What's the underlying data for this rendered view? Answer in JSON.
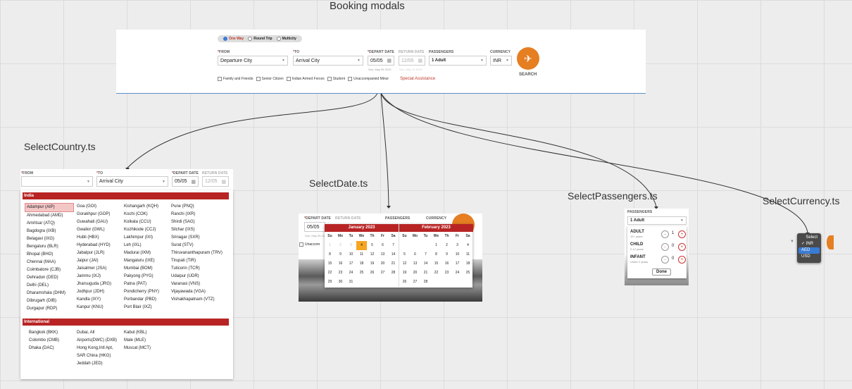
{
  "titles": {
    "page": "Booking modals",
    "select_country": "SelectCountry.ts",
    "select_date": "SelectDate.ts",
    "select_passengers": "SelectPassengers.ts",
    "select_currency": "SelectCurrency.ts"
  },
  "main_form": {
    "trip_types": [
      "One Way",
      "Round Trip",
      "Multicity"
    ],
    "from_label": "FROM",
    "from_value": "Departure City",
    "to_label": "TO",
    "to_value": "Arrival City",
    "depart_label": "DEPART DATE",
    "depart_value": "05/05",
    "depart_sub": "Sun, May 05 2019",
    "return_label": "RETURN DATE",
    "return_value": "12/05",
    "return_sub": "Sun, May 12 2019",
    "passengers_label": "PASSENGERS",
    "passengers_value": "1 Adult",
    "currency_label": "CURRENCY",
    "currency_value": "INR",
    "search_label": "SEARCH",
    "options": [
      "Family and Friends",
      "Senior Citizen",
      "Indian Armed Forces",
      "Student",
      "Unaccompanied Minor"
    ],
    "special": "Special Assistance"
  },
  "country": {
    "from_label": "FROM",
    "to_label": "TO",
    "to_value": "Arrival City",
    "depart_label": "DEPART DATE",
    "depart_value": "05/05",
    "return_label": "RETURN DATE",
    "return_value": "12/05",
    "india_header": "India",
    "india_cols": [
      [
        "Adampur (AIP)",
        "Ahmedabad (AMD)",
        "Amritsar (ATQ)",
        "Bagdogra (IXB)",
        "Belagavi (IXG)",
        "Bengaluru (BLR)",
        "Bhopal (BHO)",
        "Chennai (MAA)",
        "Coimbatore (CJB)",
        "Dehradun (DED)",
        "Delhi (DEL)",
        "Dharamshala (DHM)",
        "Dibrugarh (DIB)",
        "Durgapur (RDP)"
      ],
      [
        "Goa (GOI)",
        "Gorakhpur (GOP)",
        "Guwahati (GAU)",
        "Gwalior (GWL)",
        "Hubli (HBX)",
        "Hyderabad (HYD)",
        "Jabalpur (JLR)",
        "Jaipur (JAI)",
        "Jaisalmer (JSA)",
        "Jammu (IXJ)",
        "Jharsuguda (JRG)",
        "Jodhpur (JDH)",
        "Kandla (IXY)",
        "Kanpur (KNU)"
      ],
      [
        "Kishangarh (KQH)",
        "Kochi (COK)",
        "Kolkata (CCU)",
        "Kozhikode (CCJ)",
        "Lakhimpur (IXI)",
        "Leh (IXL)",
        "Madurai (IXM)",
        "Mangaluru (IXE)",
        "Mumbai (BOM)",
        "Pakyong (PYG)",
        "Patna (PAT)",
        "Pondicherry (PNY)",
        "Porbandar (PBD)",
        "Port Blair (IXZ)"
      ],
      [
        "Pune (PNQ)",
        "Ranchi (IXR)",
        "Shirdi (SAG)",
        "Silchar (IXS)",
        "Srinagar (SXR)",
        "Surat (STV)",
        "Thiruvananthapuram (TRV)",
        "Tirupati (TIR)",
        "Tuticorin (TCR)",
        "Udaipur (UDR)",
        "Varanasi (VNS)",
        "Vijayawada (VGA)",
        "Vishakhapatnam (VTZ)"
      ]
    ],
    "intl_header": "International",
    "intl_cols": [
      [
        "Bangkok (BKK)",
        "Colombo (CMB)",
        "Dhaka (DAC)"
      ],
      [
        "Dubai, All Airports(DWC) (DXB)",
        "Hong Kong,Intl Apt, SAR China (HKG)",
        "Jeddah (JED)"
      ],
      [
        "Kabul (KBL)",
        "Male (MLE)",
        "Muscat (MCT)"
      ]
    ]
  },
  "date": {
    "depart_label": "DEPART DATE",
    "return_label": "RETURN DATE",
    "passengers_label": "PASSENGERS",
    "currency_label": "CURRENCY",
    "depart_value": "05/05",
    "depart_sub": "Sun, May 05 2019",
    "unaccom": "Unaccom",
    "day_names": [
      "Su",
      "Mo",
      "Tu",
      "We",
      "Th",
      "Fr",
      "Sa"
    ],
    "months": [
      {
        "name": "January 2023",
        "offset": 0,
        "days": 31,
        "prev_tail": [
          1,
          2,
          3
        ],
        "today": 4
      },
      {
        "name": "February 2023",
        "offset": 3,
        "days": 28
      }
    ]
  },
  "passengers": {
    "label": "PASSENGERS",
    "value": "1 Adult",
    "rows": [
      {
        "name": "ADULT",
        "sub": "12+ years",
        "count": "1"
      },
      {
        "name": "CHILD",
        "sub": "2-12 years",
        "count": "0"
      },
      {
        "name": "INFANT",
        "sub": "Under 2 years",
        "count": "0"
      }
    ],
    "done": "Done"
  },
  "currency": {
    "options": [
      "Select",
      "INR",
      "AED",
      "USD"
    ],
    "checked": "INR",
    "highlighted": "AED"
  },
  "colors": {
    "accent": "#e67e22",
    "red": "#b82424",
    "highlight": "#3a7bd5"
  }
}
